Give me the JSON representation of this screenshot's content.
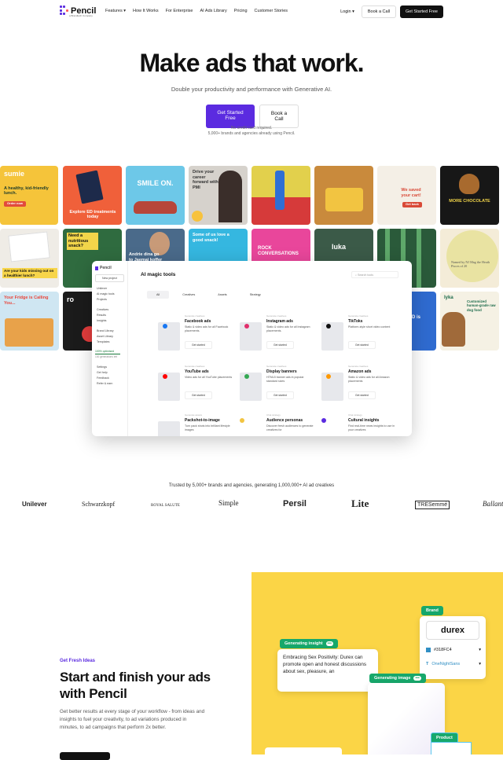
{
  "nav": {
    "logo": "Pencil",
    "logo_sub": "a Brandtech Company",
    "links": [
      "Features",
      "How It Works",
      "For Enterprise",
      "AI Ads Library",
      "Pricing",
      "Customer Stories"
    ],
    "login": "Login",
    "book_call": "Book a Call",
    "get_started": "Get Started Free"
  },
  "hero": {
    "title": "Make ads that work.",
    "subtitle": "Double your productivity and performance with Generative AI.",
    "cta_primary": "Get Started Free",
    "cta_secondary": "Book a Call",
    "note1": "No credit card required.",
    "note2": "5,000+ brands and agencies already using Pencil."
  },
  "gallery": {
    "tiles": [
      {
        "text": "sumie",
        "sub": "A healthy, kid-friendly lunch.",
        "cta": "Order now"
      },
      {
        "text": "Explore ED treatments today"
      },
      {
        "text": "SMILE ON."
      },
      {
        "text": "Drive your career forward with PMI"
      },
      {
        "text": ""
      },
      {
        "text": ""
      },
      {
        "text": "We saved your cart!",
        "cta": "Get back"
      },
      {
        "text": "MORE CHOCOLATE"
      },
      {
        "text": "Are your kids missing out on a healthier lunch?"
      },
      {
        "text": "Need a nutritious snack?"
      },
      {
        "text": "Andrie dina go to Jaemai koffer"
      },
      {
        "text": "Some of us love a good snack!"
      },
      {
        "text": "ROCK CONVERSATIONS"
      },
      {
        "text": "luka"
      },
      {
        "text": ""
      },
      {
        "text": "Named by NJ Mag the Heath Pisces of 20"
      },
      {
        "text": "Your Fridge is Calling You..."
      },
      {
        "text": "ro"
      },
      {
        "text": "ED is"
      },
      {
        "text": "lyka",
        "sub": "Customized human-grade raw dog food"
      }
    ]
  },
  "mock": {
    "logo": "Pencil",
    "new_project": "New project",
    "title": "AI magic tools",
    "search": "Search tools",
    "side": [
      "Unilever",
      "AI magic tools",
      "Projects",
      "Creatives",
      "Results",
      "Insights",
      "Brand Library",
      "Asset Library",
      "Templates",
      "Settings",
      "Get help",
      "Feedback",
      "Refer & earn"
    ],
    "optimized": "100% optimised",
    "generations": "100 generations left",
    "tabs": [
      "All",
      "Creatives",
      "Assets",
      "Strategy"
    ],
    "cards": [
      {
        "cat": "Generate creatives",
        "name": "Facebook ads",
        "desc": "Static & video ads for all Facebook placements.",
        "btn": "Get started"
      },
      {
        "cat": "Generate creatives",
        "name": "Instagram ads",
        "desc": "Static & video ads for all Instagram placements.",
        "btn": "Get started"
      },
      {
        "cat": "Generate creatives",
        "name": "TikToks",
        "desc": "Platform-style short video content",
        "btn": "Get started"
      },
      {
        "cat": "Generate creatives",
        "name": "YouTube ads",
        "desc": "Video ads for all YouTube placements",
        "btn": "Get started"
      },
      {
        "cat": "Generate creatives",
        "name": "Display banners",
        "desc": "HTML5 banner ads in popular standard sizes",
        "btn": "Get started"
      },
      {
        "cat": "Generate creatives",
        "name": "Amazon ads",
        "desc": "Static & video ads for all Amazon placements",
        "btn": "Get started"
      },
      {
        "cat": "Generate assets",
        "name": "Packshot-to-image",
        "desc": "Turn pack shots into brilliant lifestyle images",
        "btn": ""
      },
      {
        "cat": "Chat strategy",
        "name": "Audience personas",
        "desc": "Discover fresh audiences to generate creatives for",
        "btn": ""
      },
      {
        "cat": "Chat strategy",
        "name": "Cultural insights",
        "desc": "Find real-time news insights to use in your creatives",
        "btn": ""
      }
    ]
  },
  "trusted": {
    "text": "Trusted by 5,000+ brands and agencies, generating 1,000,000+ AI ad creatives",
    "brands": [
      "Unilever",
      "Schwarzkopf",
      "ROYAL SALUTE",
      "Simple",
      "Persil",
      "Lite",
      "TRESemmé",
      "Ballantine's"
    ]
  },
  "section2": {
    "eyebrow": "Get Fresh Ideas",
    "title": "Start and finish your ads with Pencil",
    "body": "Get better results at every stage of your workflow - from ideas and insights to fuel your creativity, to ad variations produced in minutes, to ad campaigns that perform 2x better."
  },
  "insight": {
    "tag": "Generating insight",
    "text": "Embracing Sex Positivity: Durex can promote open and honest discussions about sex, pleasure, an"
  },
  "brandcard": {
    "tag": "Brand",
    "logo": "durex",
    "color": "#318FC4",
    "font": "OneNightSans"
  },
  "genimage": {
    "tag": "Generating image"
  },
  "product": {
    "tag": "Product"
  },
  "colors": {
    "accent": "#5b2be0",
    "green": "#17a86b",
    "yellow": "#fbd546",
    "durex_blue": "#318FC4"
  }
}
